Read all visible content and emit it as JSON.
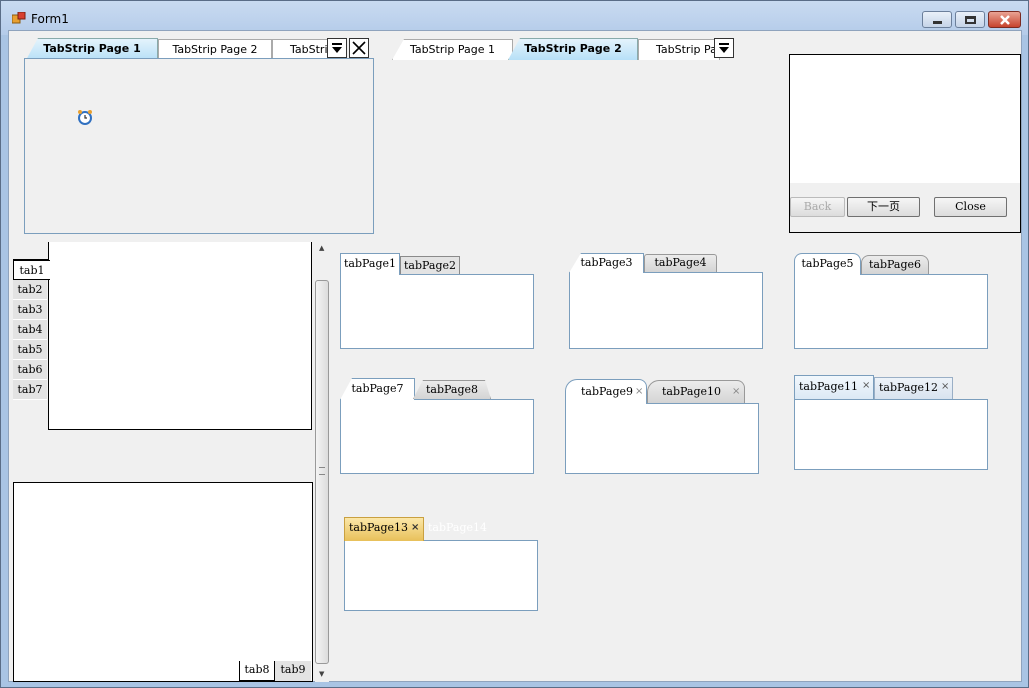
{
  "window": {
    "title": "Form1"
  },
  "strip1": {
    "tabs": [
      "TabStrip Page 1",
      "TabStrip Page 2",
      "TabStri"
    ]
  },
  "strip2": {
    "tabs": [
      "TabStrip Page 1",
      "TabStrip Page 2",
      "TabStrip Pa"
    ]
  },
  "wizard": {
    "back": "Back",
    "next": "下一页",
    "close": "Close"
  },
  "vtabs": [
    "tab1",
    "tab2",
    "tab3",
    "tab4",
    "tab5",
    "tab6",
    "tab7"
  ],
  "btabs": [
    "tab8",
    "tab9"
  ],
  "tc1": [
    "tabPage1",
    "tabPage2"
  ],
  "tc2": [
    "tabPage3",
    "tabPage4"
  ],
  "tc3": [
    "tabPage5",
    "tabPage6"
  ],
  "tc4": [
    "tabPage7",
    "tabPage8"
  ],
  "tc5": [
    "tabPage9",
    "tabPage10"
  ],
  "tc6": [
    "tabPage11",
    "tabPage12"
  ],
  "tc7": [
    "tabPage13",
    "tabPage14"
  ],
  "icons": {
    "close_tab": "×",
    "dropdown": "▼",
    "close_strip": "X"
  }
}
